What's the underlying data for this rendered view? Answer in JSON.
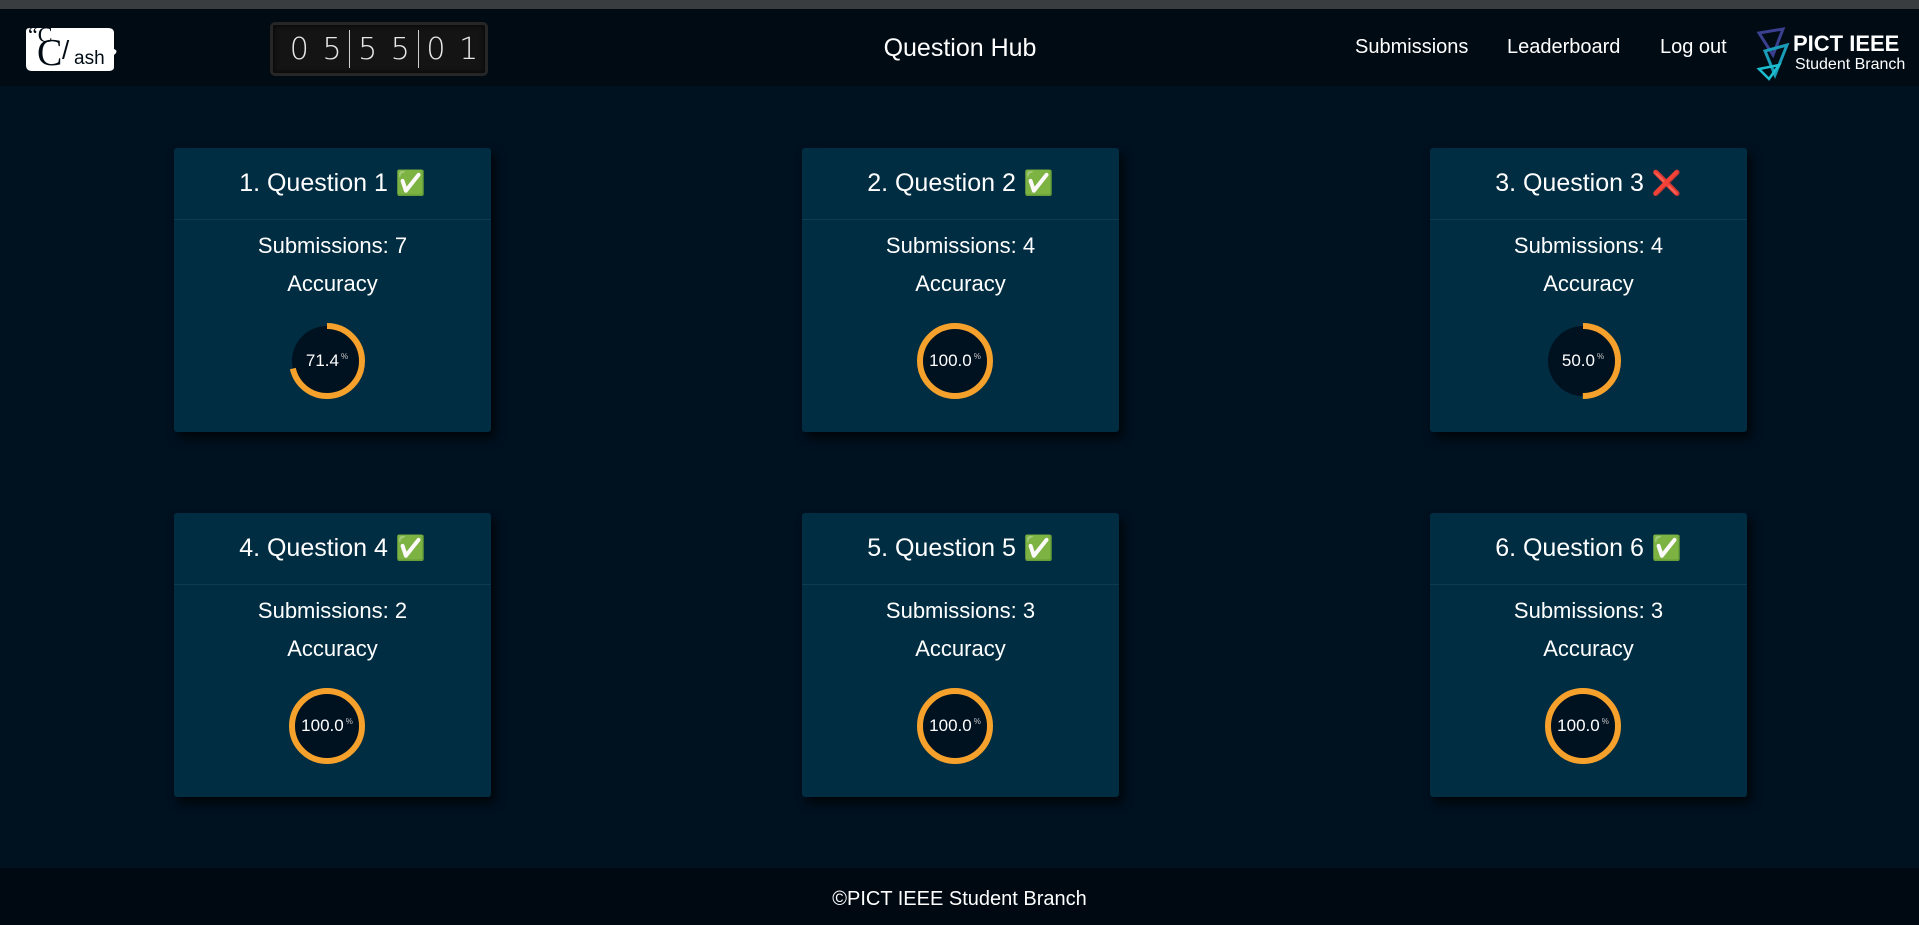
{
  "brand": {
    "logo_text": "Clash",
    "logo_quote_open": "“C",
    "logo_slash": "/",
    "logo_ash": "ash",
    "logo_quote_close": "„"
  },
  "timer": {
    "digits": [
      "0",
      "5",
      "5",
      "5",
      "0",
      "1"
    ]
  },
  "header": {
    "title": "Question Hub"
  },
  "nav": {
    "submissions": "Submissions",
    "leaderboard": "Leaderboard",
    "logout": "Log out"
  },
  "ieee": {
    "line1": "PICT IEEE",
    "line2": "Student Branch"
  },
  "colors": {
    "background": "#001120",
    "card": "#012d42",
    "ring": "#f5a12b",
    "ring_track": "#001120",
    "ok": "#2cbf4a",
    "bad": "#e0242c"
  },
  "questions": [
    {
      "title": "1. Question 1",
      "status_icon": "✅",
      "solved": true,
      "submissions_label": "Submissions: 7",
      "accuracy_label": "Accuracy",
      "accuracy": 71.4,
      "accuracy_text": "71.4",
      "unit": "%"
    },
    {
      "title": "2. Question 2",
      "status_icon": "✅",
      "solved": true,
      "submissions_label": "Submissions: 4",
      "accuracy_label": "Accuracy",
      "accuracy": 100.0,
      "accuracy_text": "100.0",
      "unit": "%"
    },
    {
      "title": "3. Question 3",
      "status_icon": "❌",
      "solved": false,
      "submissions_label": "Submissions: 4",
      "accuracy_label": "Accuracy",
      "accuracy": 50.0,
      "accuracy_text": "50.0",
      "unit": "%"
    },
    {
      "title": "4. Question 4",
      "status_icon": "✅",
      "solved": true,
      "submissions_label": "Submissions: 2",
      "accuracy_label": "Accuracy",
      "accuracy": 100.0,
      "accuracy_text": "100.0",
      "unit": "%"
    },
    {
      "title": "5. Question 5",
      "status_icon": "✅",
      "solved": true,
      "submissions_label": "Submissions: 3",
      "accuracy_label": "Accuracy",
      "accuracy": 100.0,
      "accuracy_text": "100.0",
      "unit": "%"
    },
    {
      "title": "6. Question 6",
      "status_icon": "✅",
      "solved": true,
      "submissions_label": "Submissions: 3",
      "accuracy_label": "Accuracy",
      "accuracy": 100.0,
      "accuracy_text": "100.0",
      "unit": "%"
    }
  ],
  "footer": {
    "text": "©PICT IEEE Student Branch"
  }
}
